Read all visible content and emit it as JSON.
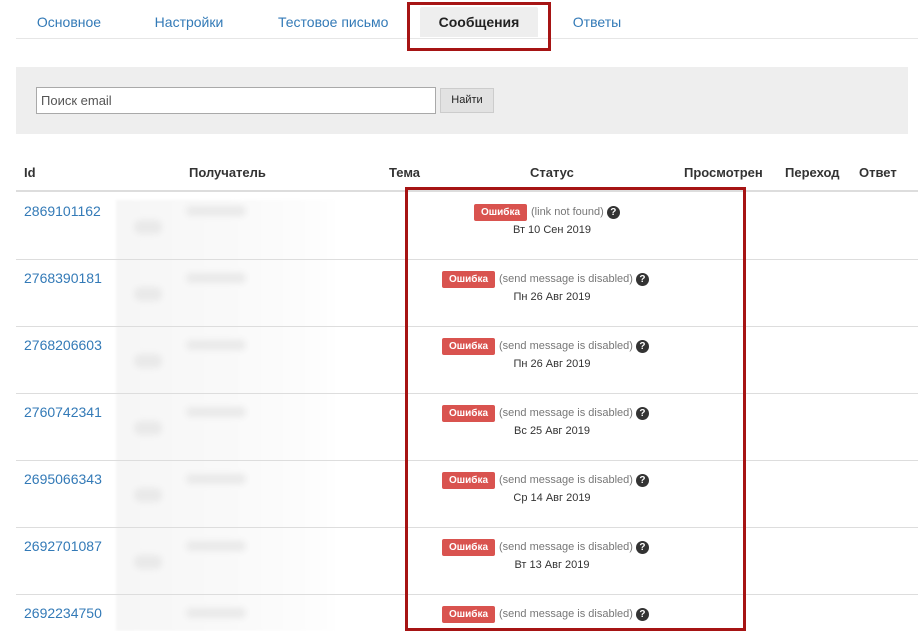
{
  "tabs": [
    {
      "label": "Основное"
    },
    {
      "label": "Настройки"
    },
    {
      "label": "Тестовое письмо"
    },
    {
      "label": "Сообщения",
      "active": true
    },
    {
      "label": "Ответы"
    }
  ],
  "search": {
    "placeholder": "Поиск email",
    "value": "",
    "button_label": "Найти"
  },
  "table": {
    "headers": {
      "id": "Id",
      "recipient": "Получатель",
      "subject": "Тема",
      "status": "Статус",
      "viewed": "Просмотрен",
      "click": "Переход",
      "reply": "Ответ"
    },
    "rows": [
      {
        "id": "2869101162",
        "badge": "Ошибка",
        "reason": "(link not found)",
        "date": "Вт 10 Сен 2019"
      },
      {
        "id": "2768390181",
        "badge": "Ошибка",
        "reason": "(send message is disabled)",
        "date": "Пн 26 Авг 2019"
      },
      {
        "id": "2768206603",
        "badge": "Ошибка",
        "reason": "(send message is disabled)",
        "date": "Пн 26 Авг 2019"
      },
      {
        "id": "2760742341",
        "badge": "Ошибка",
        "reason": "(send message is disabled)",
        "date": "Вс 25 Авг 2019"
      },
      {
        "id": "2695066343",
        "badge": "Ошибка",
        "reason": "(send message is disabled)",
        "date": "Ср 14 Авг 2019"
      },
      {
        "id": "2692701087",
        "badge": "Ошибка",
        "reason": "(send message is disabled)",
        "date": "Вт 13 Авг 2019"
      },
      {
        "id": "2692234750",
        "badge": "Ошибка",
        "reason": "(send message is disabled)",
        "date": ""
      }
    ]
  },
  "icons": {
    "help": "question-circle-icon"
  },
  "colors": {
    "link": "#337ab7",
    "error_badge": "#d9534f",
    "highlight": "#a61414",
    "panel_bg": "#eeeeee"
  }
}
